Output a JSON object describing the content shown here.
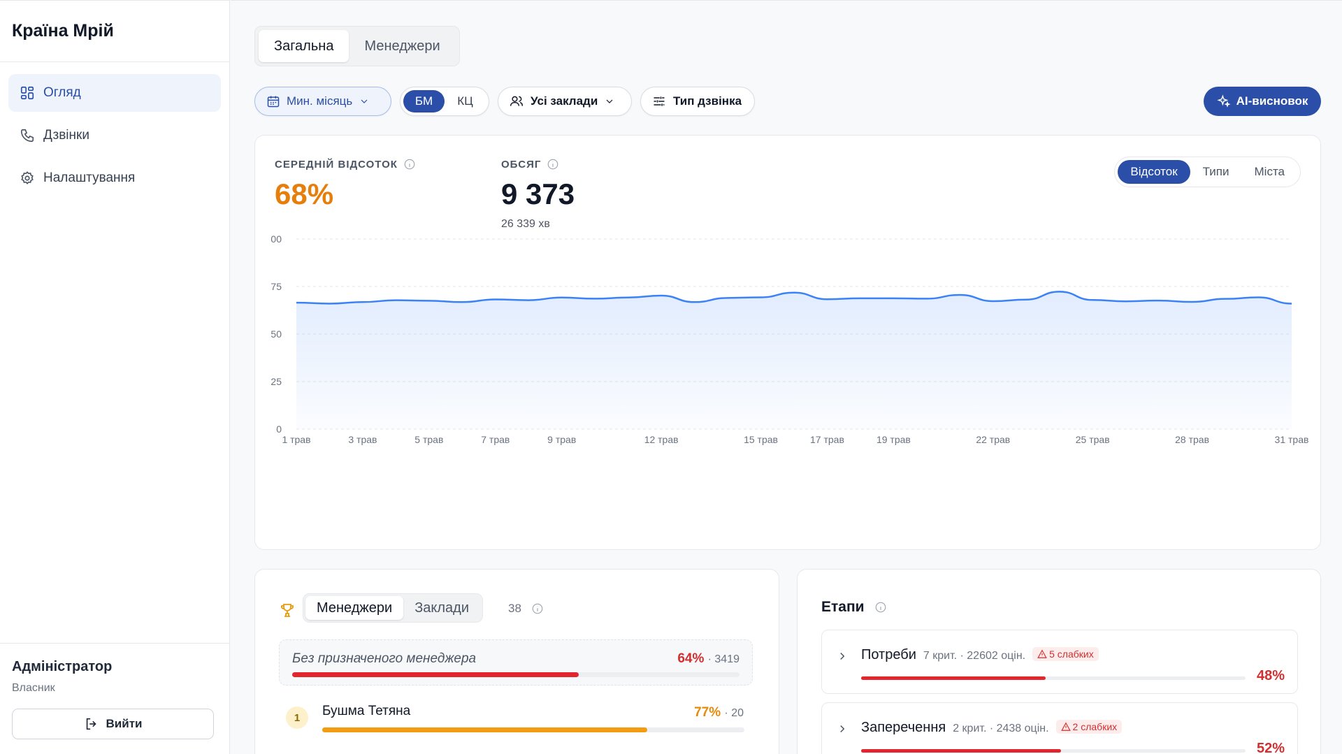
{
  "app": {
    "brand": "Країна Мрій"
  },
  "sidebar": {
    "items": [
      {
        "label": "Огляд",
        "icon": "dashboard-icon",
        "active": true
      },
      {
        "label": "Дзвінки",
        "icon": "phone-icon",
        "active": false
      },
      {
        "label": "Налаштування",
        "icon": "gear-icon",
        "active": false
      }
    ],
    "user": {
      "name": "Адміністратор",
      "role": "Власник"
    },
    "logout_label": "Вийти"
  },
  "tabs": [
    {
      "label": "Загальна",
      "active": true
    },
    {
      "label": "Менеджери",
      "active": false
    }
  ],
  "filters": {
    "period": "Мин. місяць",
    "segment": [
      {
        "label": "БМ",
        "active": true
      },
      {
        "label": "КЦ",
        "active": false
      }
    ],
    "places": "Усі заклади",
    "call_type": "Тип дзвінка",
    "ai_label": "AI-висновок"
  },
  "kpis": {
    "avg_label": "СЕРЕДНІЙ ВІДСОТОК",
    "avg_value": "68%",
    "volume_label": "ОБСЯГ",
    "volume_value": "9 373",
    "volume_sub": "26 339 хв"
  },
  "chart_tabs": [
    {
      "label": "Відсоток",
      "active": true
    },
    {
      "label": "Типи",
      "active": false
    },
    {
      "label": "Міста",
      "active": false
    }
  ],
  "colors": {
    "accent": "#2b4fa8",
    "line": "#3b82f6",
    "orange": "#e67e0b",
    "red": "#d32f2f"
  },
  "chart_data": {
    "type": "area",
    "title": "",
    "xlabel": "",
    "ylabel": "",
    "ylim": [
      0,
      100
    ],
    "y_ticks": [
      "0",
      "25",
      "50",
      "75",
      "00"
    ],
    "x_tick_labels": [
      "1 трав",
      "3 трав",
      "5 трав",
      "7 трав",
      "9 трав",
      "12 трав",
      "15 трав",
      "17 трав",
      "19 трав",
      "22 трав",
      "25 трав",
      "28 трав",
      "31 трав"
    ],
    "x_tick_days": [
      1,
      3,
      5,
      7,
      9,
      12,
      15,
      17,
      19,
      22,
      25,
      28,
      31
    ],
    "x": [
      1,
      2,
      3,
      4,
      5,
      6,
      7,
      8,
      9,
      10,
      11,
      12,
      13,
      14,
      15,
      16,
      17,
      18,
      19,
      20,
      21,
      22,
      23,
      24,
      25,
      26,
      27,
      28,
      29,
      30,
      31
    ],
    "series": [
      {
        "values": [
          66.5,
          66.0,
          66.8,
          67.8,
          67.5,
          66.8,
          68.2,
          67.8,
          69.2,
          68.6,
          69.2,
          70.2,
          66.8,
          69.0,
          69.3,
          71.8,
          68.3,
          68.8,
          68.8,
          68.6,
          70.6,
          67.3,
          68.1,
          72.3,
          67.9,
          67.2,
          67.6,
          66.9,
          68.5,
          69.3,
          66.0
        ]
      }
    ],
    "grid": true
  },
  "leaderboard": {
    "tabs": [
      {
        "label": "Менеджери",
        "active": true
      },
      {
        "label": "Заклади",
        "active": false
      }
    ],
    "count": "38",
    "unassigned": {
      "name": "Без призначеного менеджера",
      "pct": "64%",
      "count": "· 3419",
      "value": 64
    },
    "managers": [
      {
        "rank": "1",
        "name": "Бушма Тетяна",
        "pct": "77%",
        "count": "· 20",
        "value": 77
      }
    ]
  },
  "stages": {
    "title": "Етапи",
    "items": [
      {
        "name": "Потреби",
        "meta": "7 крит. · 22602 оцін.",
        "weak": "5 слабких",
        "pct": "48%",
        "value": 48
      },
      {
        "name": "Заперечення",
        "meta": "2 крит. · 2438 оцін.",
        "weak": "2 слабких",
        "pct": "52%",
        "value": 52
      }
    ]
  }
}
